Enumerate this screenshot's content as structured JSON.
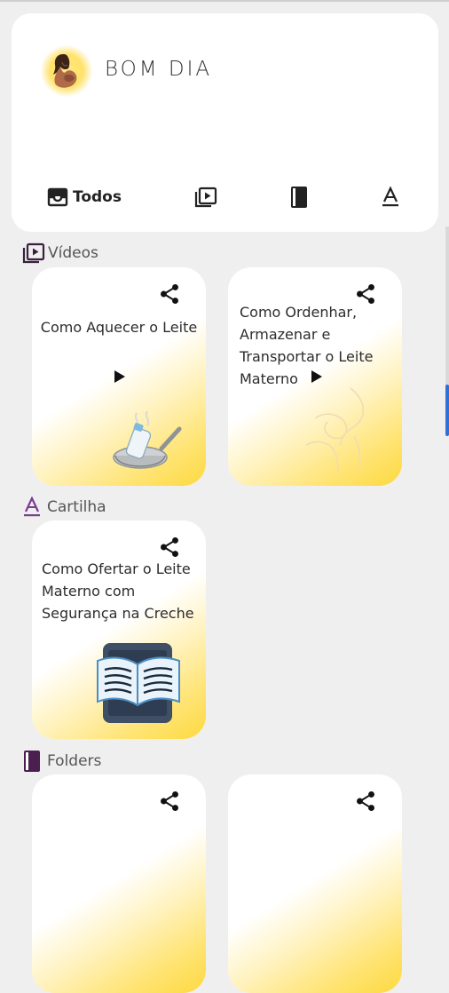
{
  "header": {
    "greeting": "BOM DIA",
    "filters": [
      {
        "label": "Todos",
        "icon": "inbox-icon"
      },
      {
        "label": "",
        "icon": "video-library-icon"
      },
      {
        "label": "",
        "icon": "book-icon"
      },
      {
        "label": "",
        "icon": "text-format-icon"
      }
    ]
  },
  "sections": {
    "videos": {
      "title": "Vídeos",
      "cards": [
        {
          "title": "Como Aquecer o Leite"
        },
        {
          "title": "Como Ordenhar, Armazenar e Transportar o Leite Materno"
        }
      ]
    },
    "cartilha": {
      "title": "Cartilha",
      "cards": [
        {
          "title": "Como Ofertar o Leite Materno com Segurança na Creche"
        }
      ]
    },
    "folders": {
      "title": "Folders"
    }
  },
  "colors": {
    "accent_yellow": "#fcd93f",
    "cartilha_purple": "#7a3d8f",
    "folders_purple": "#4b1f4f",
    "scrollbar_blue": "#2f6fd8"
  }
}
